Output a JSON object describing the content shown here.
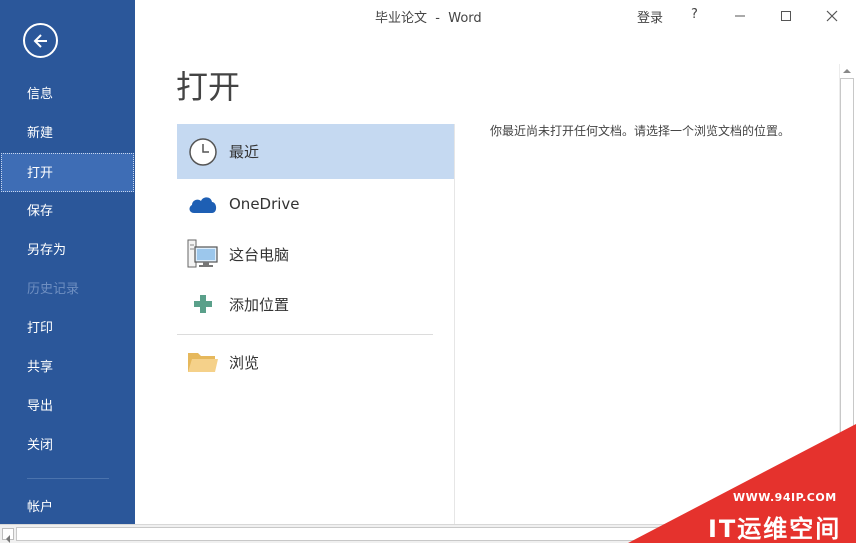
{
  "window": {
    "title": "毕业论文  -  Word",
    "sign_in": "登录",
    "help": "?",
    "controls": [
      "minimize-icon",
      "maximize-icon",
      "close-icon"
    ]
  },
  "sidebar": {
    "back_icon": "back-arrow-icon",
    "items": [
      {
        "label": "信息",
        "state": "normal"
      },
      {
        "label": "新建",
        "state": "normal"
      },
      {
        "label": "打开",
        "state": "selected"
      },
      {
        "label": "保存",
        "state": "normal"
      },
      {
        "label": "另存为",
        "state": "normal"
      },
      {
        "label": "历史记录",
        "state": "disabled"
      },
      {
        "label": "打印",
        "state": "normal"
      },
      {
        "label": "共享",
        "state": "normal"
      },
      {
        "label": "导出",
        "state": "normal"
      },
      {
        "label": "关闭",
        "state": "normal"
      }
    ],
    "account": "帐户",
    "color": "#2b579a"
  },
  "main": {
    "title": "打开",
    "places": [
      {
        "label": "最近",
        "icon": "clock-icon",
        "selected": true
      },
      {
        "label": "OneDrive",
        "icon": "cloud-icon",
        "selected": false
      },
      {
        "label": "这台电脑",
        "icon": "computer-icon",
        "selected": false
      },
      {
        "label": "添加位置",
        "icon": "plus-icon",
        "selected": false
      },
      {
        "label": "浏览",
        "icon": "folder-icon",
        "selected": false
      }
    ],
    "empty_message": "你最近尚未打开任何文档。请选择一个浏览文档的位置。"
  },
  "watermark": {
    "line1": "WWW.94IP.COM",
    "line2": "IT运维空间"
  }
}
